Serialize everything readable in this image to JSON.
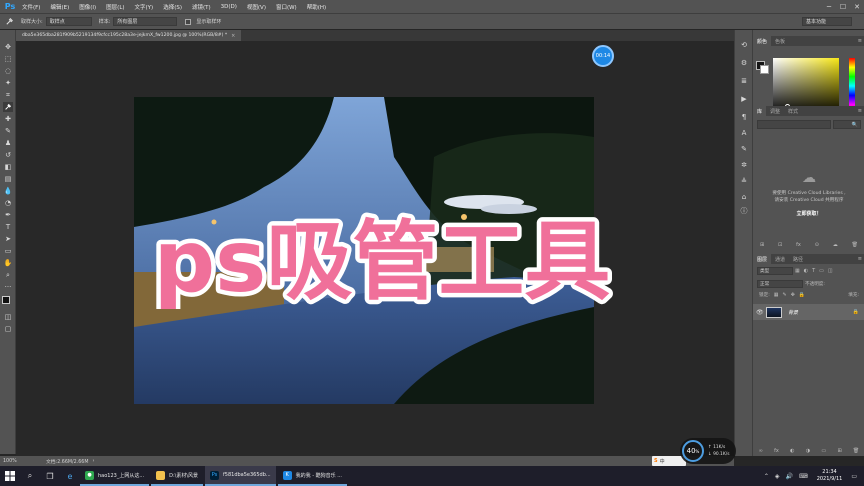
{
  "menubar": {
    "logo": "Ps",
    "items": [
      "文件(F)",
      "编辑(E)",
      "图像(I)",
      "图层(L)",
      "文字(Y)",
      "选择(S)",
      "滤镜(T)",
      "3D(D)",
      "视图(V)",
      "窗口(W)",
      "帮助(H)"
    ],
    "minimize": "─",
    "maximize": "☐",
    "close": "✕"
  },
  "options": {
    "sample_size_label": "取样大小:",
    "sample_size_value": "取样点",
    "sample_label": "样本:",
    "sample_value": "所有图层",
    "show_ring_label": "显示取样环",
    "workspace": "基本功能"
  },
  "document": {
    "tab_title": "dba5e365dba281f909b5219134f9cfcc195c28a3e-jejkmX_fw1200.jpg @ 100%(RGB/8#) *",
    "tab_close": "×",
    "timer": "00:14",
    "overlay_title": "ps吸管工具"
  },
  "status": {
    "zoom": "100%",
    "doc_info": "文档:2.66M/2.66M",
    "arrow": "›"
  },
  "color_panel": {
    "tabs": [
      "颜色",
      "色板"
    ],
    "menu": "≡"
  },
  "library_panel": {
    "tabs": [
      "库",
      "调整",
      "样式"
    ],
    "search_icon": "🔍",
    "message_line1": "要使用 Creative Cloud Libraries ,",
    "message_line2": "请安装 Creative Cloud 共用程序",
    "link": "立即获取！",
    "footer_icons": [
      "⊞",
      "⊡",
      "fx",
      "⊙",
      "☁",
      "🗑"
    ]
  },
  "layers_panel": {
    "tabs": [
      "图层",
      "通道",
      "路径"
    ],
    "kind_label": "类型",
    "blend_mode": "正常",
    "opacity_label": "不透明度:",
    "lock_label": "锁定:",
    "fill_label": "填充:",
    "layer_name": "背景",
    "footer_icons": [
      "∞",
      "fx",
      "◐",
      "◑",
      "▭",
      "⊞",
      "🗑"
    ]
  },
  "widgets": {
    "speed_value": "40",
    "speed_unit": "%",
    "upload": "↑ 11K/s",
    "download": "↓ 90.1K/s",
    "ime": "中"
  },
  "taskbar": {
    "apps": [
      {
        "label": "hao123_上网从这...",
        "icon_color": "#2fa84f"
      },
      {
        "label": "D:\\素材\\风景",
        "icon_color": "#f2c14e"
      },
      {
        "label": "f581dba5e365db...",
        "icon_color": "#001e36"
      },
      {
        "label": "我的我 - 酷狗音乐 ...",
        "icon_color": "#1e88e5"
      }
    ],
    "time": "21:34",
    "date": "2021/9/11"
  },
  "colors": {
    "accent": "#31a8ff",
    "title_fill": "#f0709a",
    "title_stroke": "#ffffff"
  }
}
